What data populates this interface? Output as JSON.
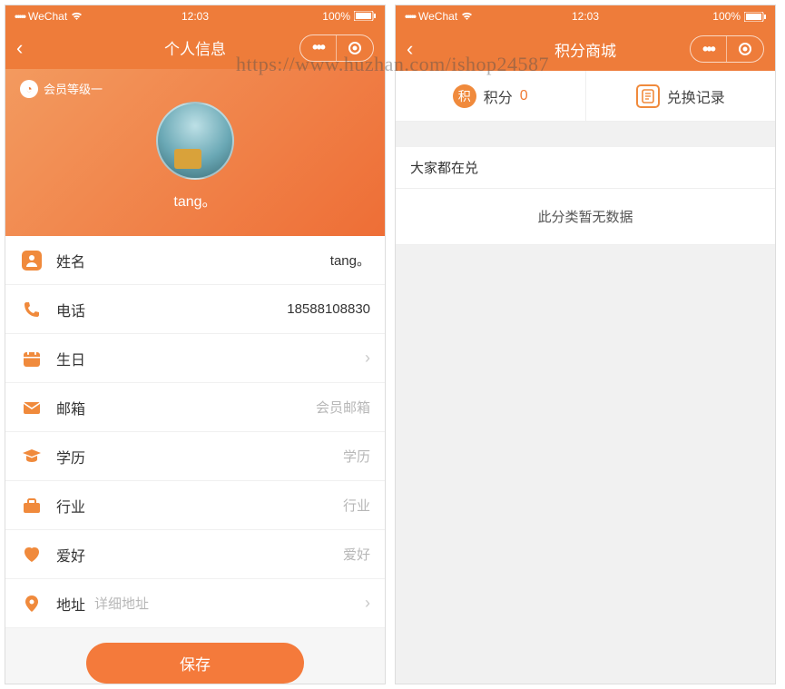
{
  "watermark": "https://www.huzhan.com/ishop24587",
  "status": {
    "carrier": "WeChat",
    "time": "12:03",
    "battery": "100%"
  },
  "screen1": {
    "nav_title": "个人信息",
    "member_level": "会员等级一",
    "username": "tang。",
    "rows": {
      "name": {
        "label": "姓名",
        "value": "tang。"
      },
      "phone": {
        "label": "电话",
        "value": "18588108830"
      },
      "birth": {
        "label": "生日"
      },
      "email": {
        "label": "邮箱",
        "placeholder": "会员邮箱"
      },
      "edu": {
        "label": "学历",
        "placeholder": "学历"
      },
      "industry": {
        "label": "行业",
        "placeholder": "行业"
      },
      "hobby": {
        "label": "爱好",
        "placeholder": "爱好"
      },
      "address": {
        "label": "地址",
        "placeholder": "详细地址"
      }
    },
    "save_label": "保存"
  },
  "screen2": {
    "nav_title": "积分商城",
    "tabs": {
      "points_label": "积分",
      "points_value": "0",
      "history_label": "兑换记录",
      "points_icon_text": "积"
    },
    "section_title": "大家都在兑",
    "empty_text": "此分类暂无数据"
  }
}
